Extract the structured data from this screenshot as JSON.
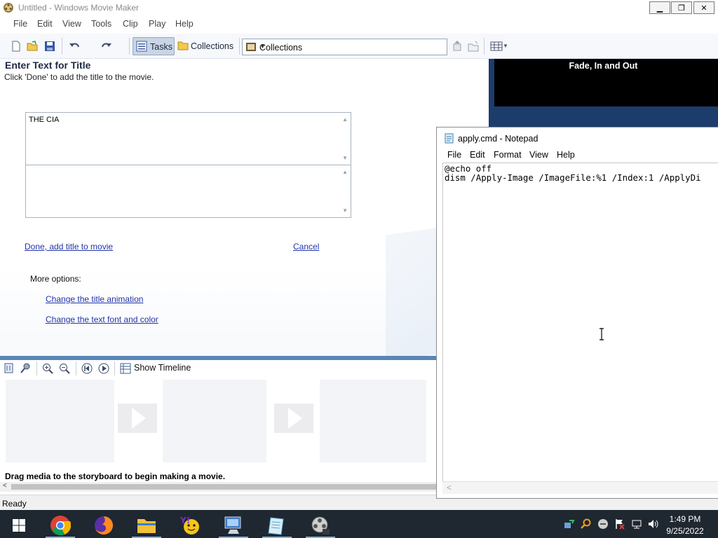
{
  "movie_maker": {
    "title": "Untitled - Windows Movie Maker",
    "menu": [
      "File",
      "Edit",
      "View",
      "Tools",
      "Clip",
      "Play",
      "Help"
    ],
    "toolbar": {
      "tasks_label": "Tasks",
      "collections_label": "Collections",
      "collections_combo": "Collections"
    },
    "task_pane": {
      "heading": "Enter Text for Title",
      "instruction": "Click 'Done' to add the title to the movie.",
      "title_text": "THE CIA",
      "subtitle_text": "",
      "done_link": "Done, add title to movie",
      "cancel_link": "Cancel",
      "more_options_label": "More options:",
      "change_animation_link": "Change the title animation",
      "change_font_link": "Change the text font and color"
    },
    "preview": {
      "effect_label": "Fade, In and Out"
    },
    "storyboard": {
      "show_timeline_label": "Show Timeline",
      "message": "Drag media to the storyboard to begin making a movie."
    },
    "status": "Ready"
  },
  "notepad": {
    "title": "apply.cmd - Notepad",
    "menu": [
      "File",
      "Edit",
      "Format",
      "View",
      "Help"
    ],
    "content": "@echo off\ndism /Apply-Image /ImageFile:%1 /Index:1 /ApplyDi"
  },
  "taskbar": {
    "apps": [
      "start-icon",
      "chrome-icon",
      "firefox-icon",
      "file-explorer-icon",
      "yahoo-messenger-icon",
      "computer-icon",
      "notepad-icon",
      "movie-maker-icon"
    ],
    "time": "1:49 PM",
    "date": "9/25/2022"
  },
  "colors": {
    "preview_bg": "#1c3c6c",
    "link": "#2134a8",
    "taskbar": "#1f2730"
  }
}
